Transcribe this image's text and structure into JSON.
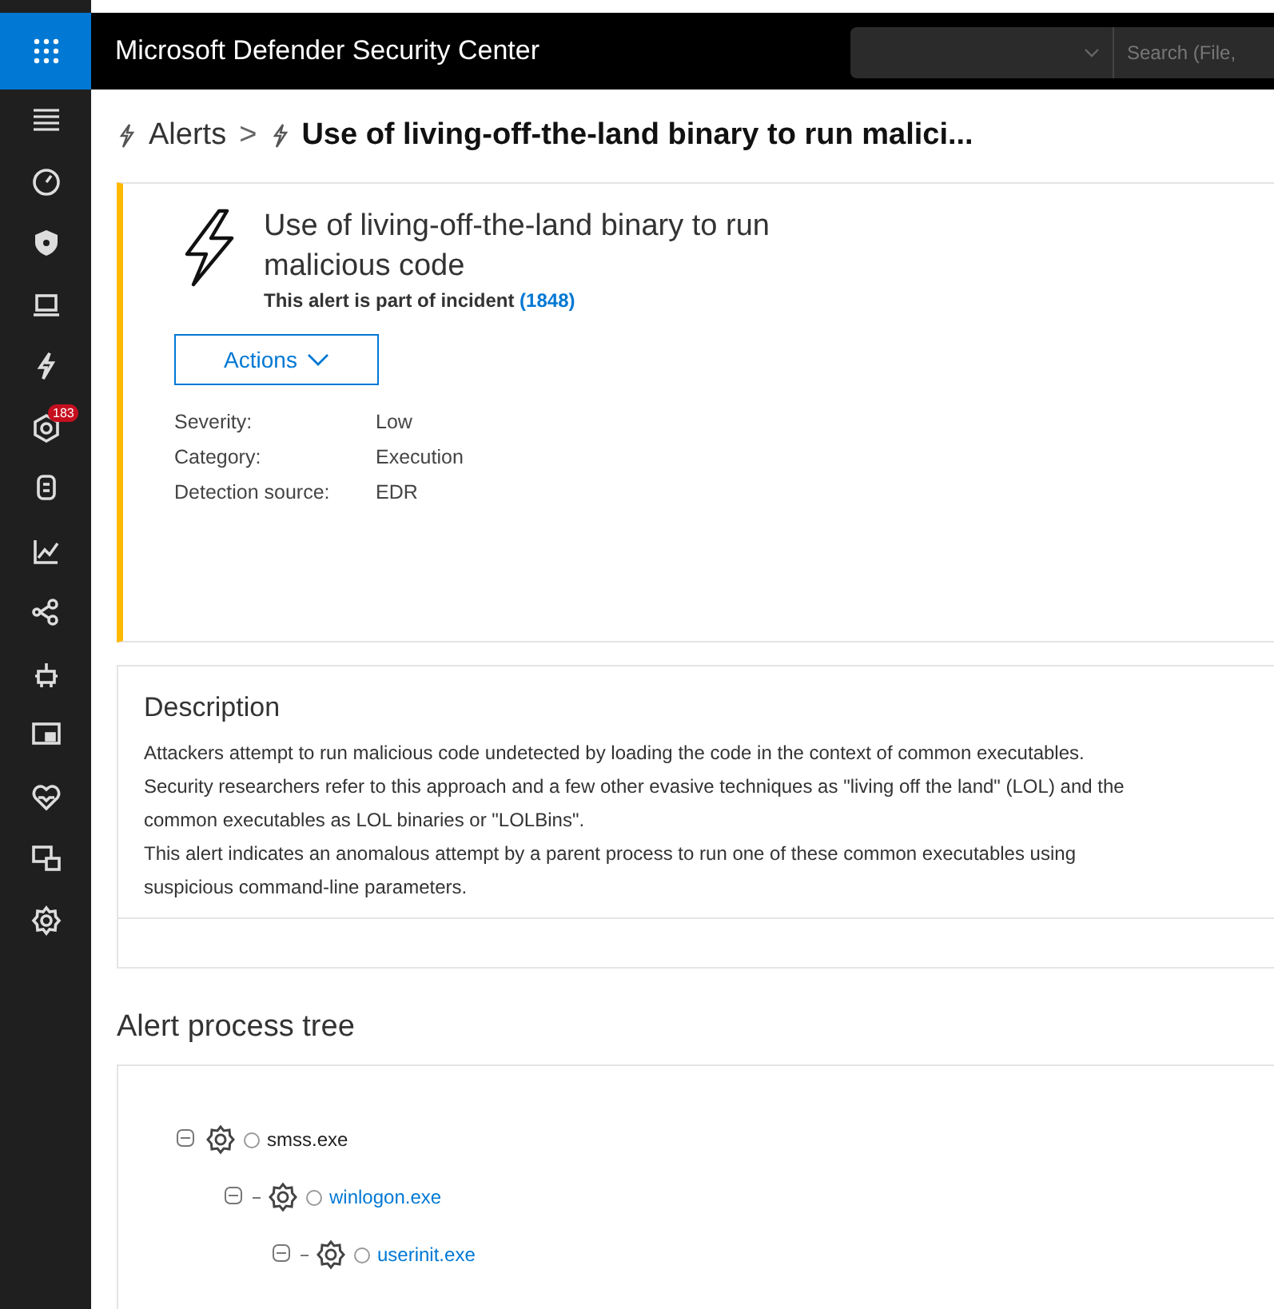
{
  "header": {
    "title": "Microsoft Defender Security Center",
    "search": {
      "placeholder": "Search (File,"
    }
  },
  "sidebar": {
    "alerts_badge": "183"
  },
  "breadcrumb": {
    "parent": "Alerts",
    "separator": ">",
    "current": "Use of living-off-the-land binary to run malici..."
  },
  "alert": {
    "title": "Use of living-off-the-land binary to run malicious code",
    "incident_text": "This alert is part of incident",
    "incident_link": "(1848)",
    "actions_button": "Actions",
    "details": [
      {
        "label": "Severity:",
        "value": "Low"
      },
      {
        "label": "Category:",
        "value": "Execution"
      },
      {
        "label": "Detection source:",
        "value": "EDR"
      }
    ]
  },
  "description": {
    "heading": "Description",
    "paragraphs": [
      "Attackers attempt to run malicious code undetected by loading the code in the context of common executables. Security researchers refer to this approach and a few other evasive techniques as \"living off the land\" (LOL) and the common executables as LOL binaries or \"LOLBins\".",
      "This alert indicates an anomalous attempt by a parent process to run one of these common executables using suspicious command-line parameters."
    ]
  },
  "process_tree": {
    "heading": "Alert process tree",
    "nodes": [
      {
        "name": "smss.exe",
        "link": false,
        "expanded": true,
        "children": [
          {
            "name": "winlogon.exe",
            "link": true,
            "expanded": true,
            "children": [
              {
                "name": "userinit.exe",
                "link": true,
                "expanded": true
              }
            ]
          }
        ]
      }
    ]
  }
}
